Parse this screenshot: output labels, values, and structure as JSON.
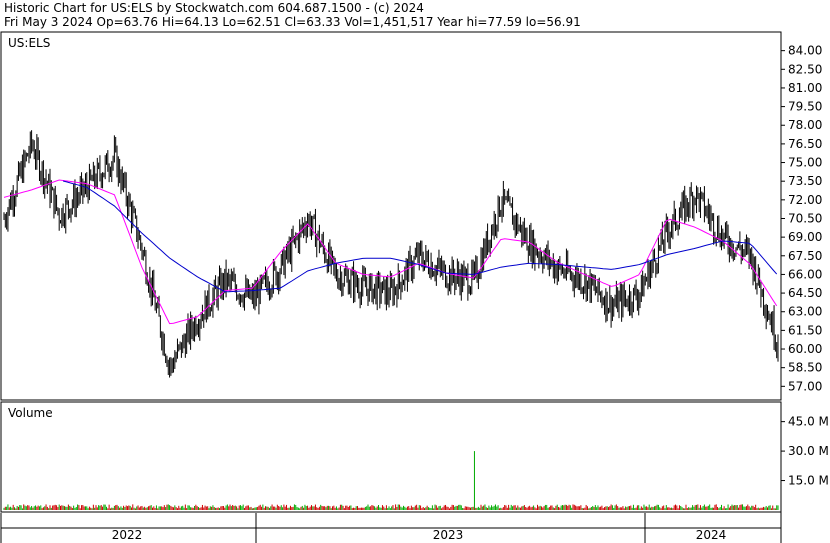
{
  "header": {
    "line1": "Historic Chart for US:ELS by Stockwatch.com 604.687.1500 - (c) 2024",
    "line2": "Fri May  3 2024  Op=63.76  Hi=64.13  Lo=62.51  Cl=63.33  Vol=1,451,517  Year hi=77.59  lo=56.91"
  },
  "chart_data": [
    {
      "type": "line",
      "title": "US:ELS",
      "xlabel": "",
      "ylabel": "",
      "ylim": [
        55.9,
        85.5
      ],
      "y_ticks": [
        "84.00",
        "82.50",
        "81.00",
        "79.50",
        "78.00",
        "76.50",
        "75.00",
        "73.50",
        "72.00",
        "70.50",
        "69.00",
        "67.50",
        "66.00",
        "64.50",
        "63.00",
        "61.50",
        "60.00",
        "58.50",
        "57.00"
      ],
      "x_labels": [
        "2022",
        "2023",
        "2024"
      ],
      "x": [
        "2022-01",
        "2022-02",
        "2022-03",
        "2022-04",
        "2022-05",
        "2022-06",
        "2022-07",
        "2022-08",
        "2022-09",
        "2022-10",
        "2022-11",
        "2022-12",
        "2023-01",
        "2023-02",
        "2023-03",
        "2023-04",
        "2023-05",
        "2023-06",
        "2023-07",
        "2023-08",
        "2023-09",
        "2023-10",
        "2023-11",
        "2023-12",
        "2024-01",
        "2024-02",
        "2024-03",
        "2024-04",
        "2024-05"
      ],
      "series": [
        {
          "style": "price",
          "color": "#000000",
          "values": [
            70.5,
            76.5,
            70.8,
            73.0,
            75.5,
            68.0,
            58.5,
            62.5,
            65.5,
            64.0,
            66.5,
            70.5,
            66.0,
            65.0,
            64.5,
            67.5,
            66.0,
            65.5,
            72.0,
            68.5,
            66.5,
            65.5,
            63.5,
            64.5,
            69.5,
            72.5,
            69.0,
            67.5,
            60.5
          ]
        },
        {
          "style": "moving-average",
          "color": "#ff00ff",
          "values": [
            72.2,
            72.8,
            73.6,
            73.3,
            72.4,
            66.5,
            62.0,
            62.6,
            64.7,
            64.9,
            67.8,
            70.1,
            66.9,
            66.0,
            65.8,
            66.9,
            66.1,
            65.7,
            68.9,
            68.6,
            67.0,
            66.0,
            65.0,
            66.0,
            70.5,
            69.8,
            68.7,
            66.8,
            63.3
          ]
        },
        {
          "style": "moving-average",
          "color": "#0000cc",
          "values": [
            null,
            null,
            73.6,
            73.0,
            71.5,
            69.3,
            67.3,
            65.8,
            64.6,
            64.7,
            64.9,
            66.3,
            66.9,
            67.3,
            67.3,
            66.8,
            66.1,
            66.0,
            66.6,
            66.9,
            66.8,
            66.6,
            66.4,
            66.8,
            67.6,
            68.1,
            68.7,
            68.5,
            65.9
          ]
        }
      ]
    },
    {
      "type": "bar",
      "title": "Volume",
      "ylabel": "",
      "ylim": [
        0,
        55
      ],
      "y_ticks": [
        "45.0 M",
        "30.0 M",
        "15.0 M"
      ],
      "baseline_volume_m": 1.6,
      "volume_spike": {
        "date": "2023-06",
        "value_m": 30.0,
        "color": "#00aa00"
      },
      "up_color": "#00aa00",
      "down_color": "#cc0000"
    }
  ],
  "footer": {
    "year_labels": [
      "2022",
      "2023",
      "2024"
    ]
  }
}
